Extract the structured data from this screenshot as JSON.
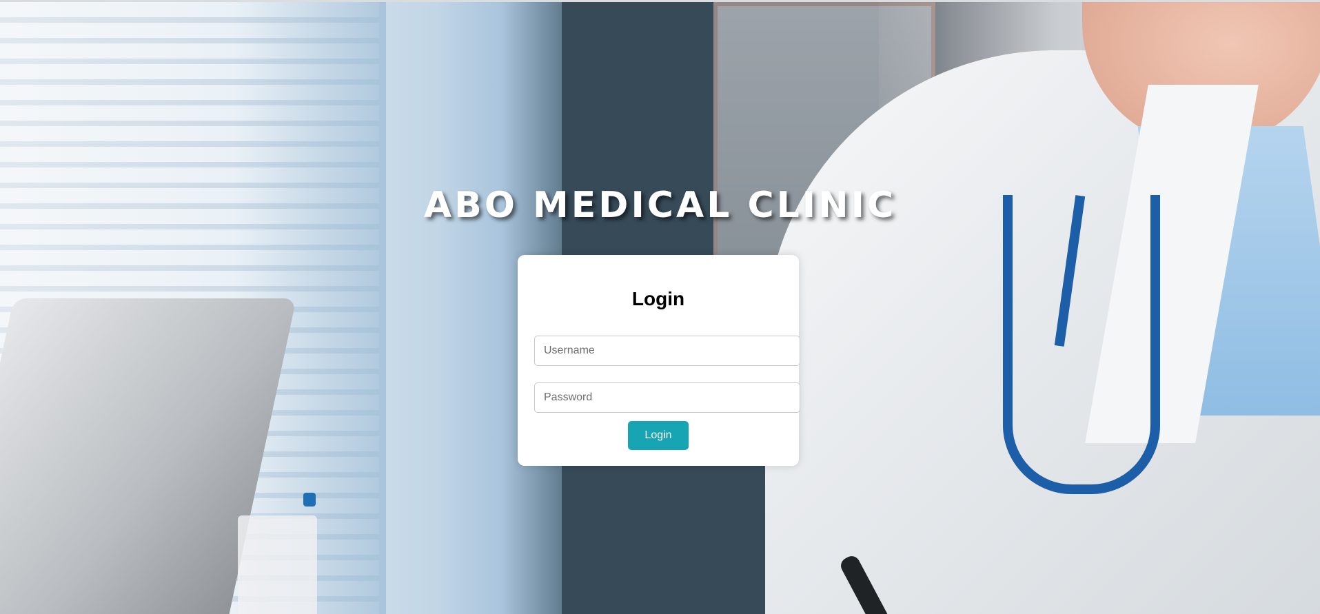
{
  "header": {
    "clinic_name": "ABO MEDICAL CLINIC"
  },
  "login_card": {
    "title": "Login",
    "username": {
      "placeholder": "Username",
      "value": ""
    },
    "password": {
      "placeholder": "Password",
      "value": ""
    },
    "submit_label": "Login"
  },
  "colors": {
    "accent": "#17a5b4",
    "card_background": "#ffffff",
    "title_text": "#ffffff"
  },
  "background": {
    "image_subject": "doctor-in-white-coat-with-stethoscope-at-desk"
  }
}
